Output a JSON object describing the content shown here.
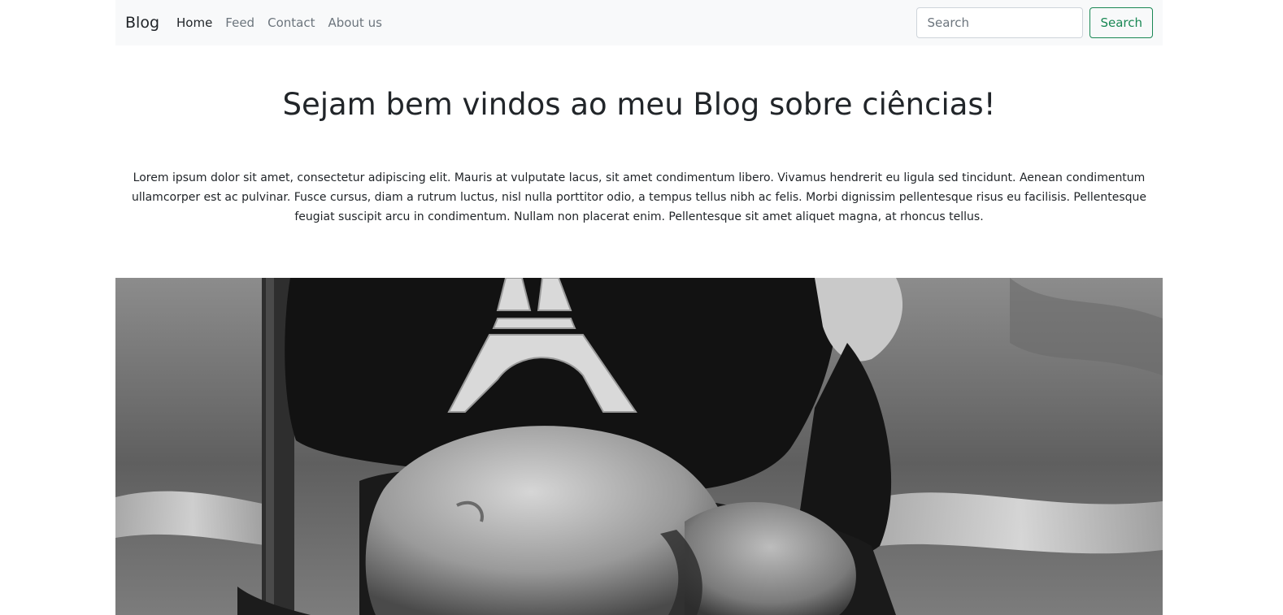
{
  "navbar": {
    "brand": "Blog",
    "links": [
      {
        "label": "Home",
        "active": true
      },
      {
        "label": "Feed",
        "active": false
      },
      {
        "label": "Contact",
        "active": false
      },
      {
        "label": "About us",
        "active": false
      }
    ],
    "search": {
      "placeholder": "Search",
      "value": "",
      "button_label": "Search"
    }
  },
  "main": {
    "title": "Sejam bem vindos ao meu Blog sobre ciências!",
    "intro": "Lorem ipsum dolor sit amet, consectetur adipiscing elit. Mauris at vulputate lacus, sit amet condimentum libero. Vivamus hendrerit eu ligula sed tincidunt. Aenean condimentum ullamcorper est ac pulvinar. Fusce cursus, diam a rutrum luctus, nisl nulla porttitor odio, a tempus tellus nibh ac felis. Morbi dignissim pellentesque risus eu facilisis. Pellentesque feugiat suscipit arcu in condimentum. Nullam non placerat enim. Pellentesque sit amet aliquet magna, at rhoncus tellus."
  },
  "colors": {
    "navbar_bg": "#f8f9fa",
    "accent_success": "#198754",
    "nav_link_muted": "#6c757d",
    "text": "#212529"
  }
}
